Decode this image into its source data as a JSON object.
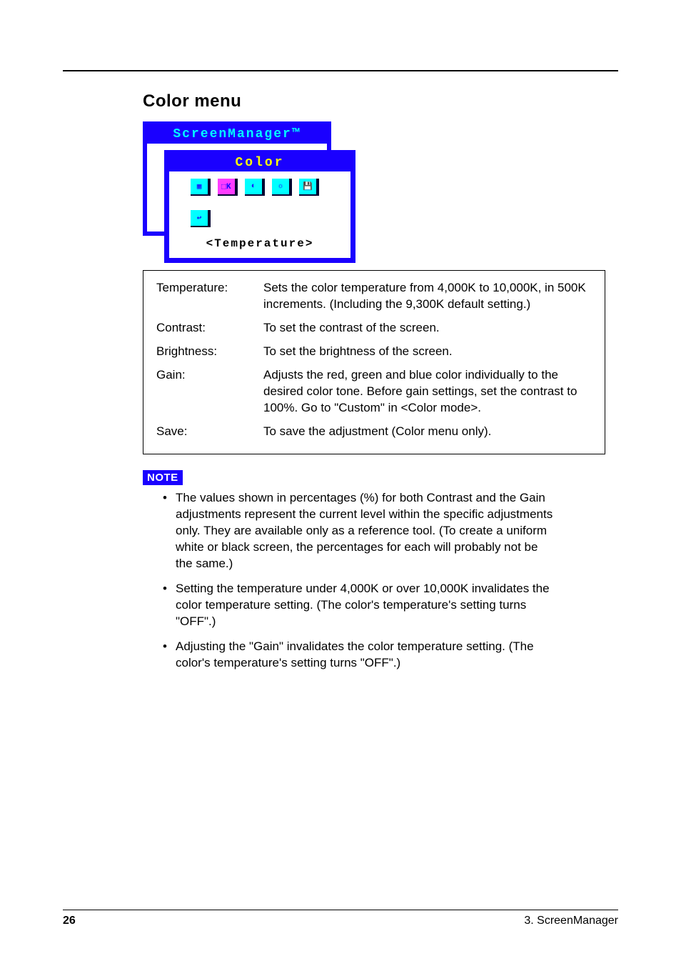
{
  "section_title": "Color menu",
  "osd": {
    "back_title": "ScreenManager™",
    "front_title": "Color",
    "icons": [
      {
        "label": "▦",
        "name": "color-mode-icon",
        "selected": false
      },
      {
        "label": "⬚K",
        "name": "temperature-icon",
        "selected": true
      },
      {
        "label": "◐",
        "name": "contrast-icon",
        "selected": false
      },
      {
        "label": "☼",
        "name": "brightness-icon",
        "selected": false
      },
      {
        "label": "💾",
        "name": "save-icon",
        "selected": false
      },
      {
        "label": "↩",
        "name": "return-icon",
        "selected": false
      }
    ],
    "selected_label": "Temperature"
  },
  "defs": [
    {
      "term": "Temperature",
      "desc": "Sets the color temperature from 4,000K to 10,000K, in 500K increments. (Including the 9,300K default setting.)"
    },
    {
      "term": "Contrast",
      "desc": "To set the contrast of the screen."
    },
    {
      "term": "Brightness",
      "desc": "To set the brightness of the screen."
    },
    {
      "term": "Gain",
      "desc": "Adjusts the red, green and blue color individually to the desired color tone. Before gain settings, set the contrast to 100%. Go to \"Custom\" in <Color mode>."
    },
    {
      "term": "Save",
      "desc": "To save the adjustment (Color menu only)."
    }
  ],
  "note_label": "NOTE",
  "notes": [
    "The values shown in percentages (%) for both Contrast and the Gain adjustments represent the current level within the specific adjustments only. They are available only as a reference tool. (To create a uniform white or black screen, the percentages for each will probably not be the same.)",
    "Setting the temperature under 4,000K or over 10,000K invalidates the color temperature setting. (The color's temperature's setting turns \"OFF\".)",
    "Adjusting the \"Gain\" invalidates the color temperature setting. (The color's temperature's setting turns \"OFF\".)"
  ],
  "footer": {
    "page": "26",
    "chapter": "3. ScreenManager"
  }
}
